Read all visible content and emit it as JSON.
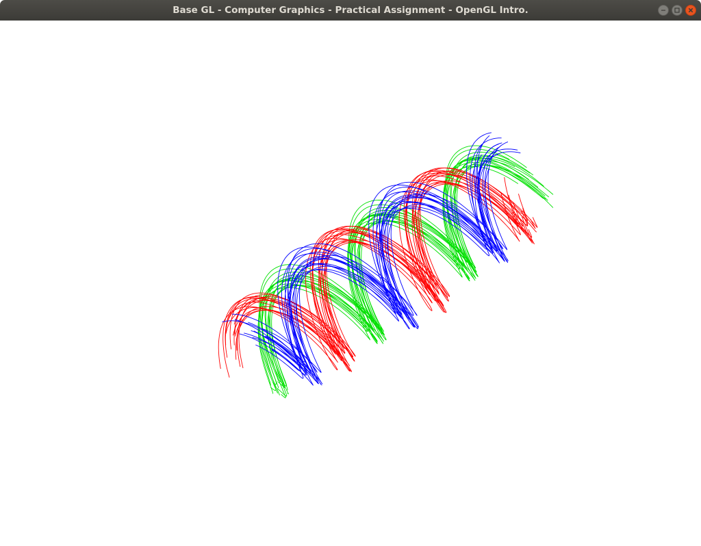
{
  "window": {
    "title": "Base GL - Computer Graphics - Practical Assignment - OpenGL Intro."
  },
  "controls": {
    "minimize": "minimize-icon",
    "maximize": "maximize-icon",
    "close": "close-icon"
  },
  "scene": {
    "background": "#ffffff",
    "colors": {
      "red": "#ff0000",
      "green": "#00e000",
      "blue": "#0000ff"
    }
  }
}
